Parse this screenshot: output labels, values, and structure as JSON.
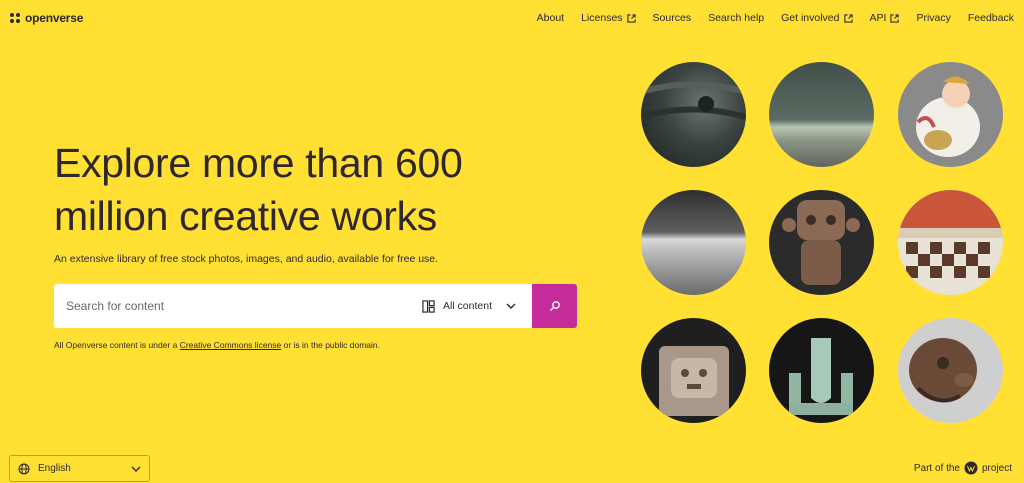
{
  "brand": {
    "name": "openverse"
  },
  "nav": {
    "items": [
      {
        "label": "About",
        "external": false
      },
      {
        "label": "Licenses",
        "external": true
      },
      {
        "label": "Sources",
        "external": false
      },
      {
        "label": "Search help",
        "external": false
      },
      {
        "label": "Get involved",
        "external": true
      },
      {
        "label": "API",
        "external": true
      },
      {
        "label": "Privacy",
        "external": false
      },
      {
        "label": "Feedback",
        "external": false
      }
    ]
  },
  "hero": {
    "title_line1": "Explore more than 600",
    "title_line2": "million creative works",
    "tagline": "An extensive library of free stock photos, images, and audio, available for free use."
  },
  "search": {
    "placeholder": "Search for content",
    "content_type": "All content"
  },
  "license_note": {
    "prefix": "All Openverse content is under a ",
    "link": "Creative Commons license",
    "suffix": " or is in the public domain."
  },
  "footer": {
    "language": "English",
    "part_of_prefix": "Part of the",
    "part_of_suffix": "project"
  },
  "colors": {
    "background": "#ffe033",
    "accent": "#c52b9b",
    "text": "#30272e"
  }
}
